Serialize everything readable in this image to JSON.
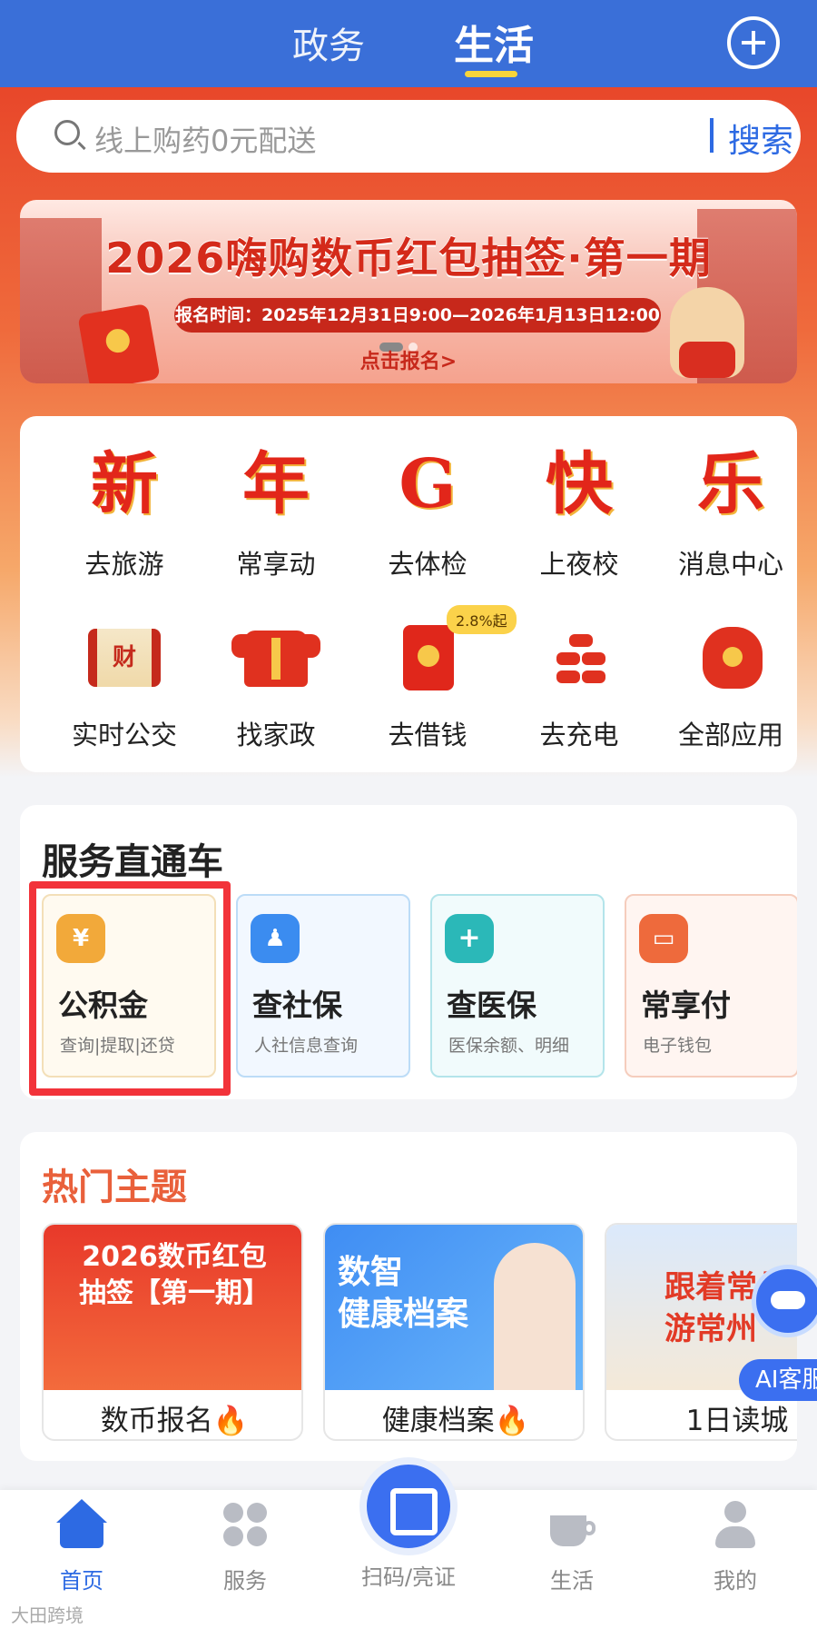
{
  "header": {
    "tabs": [
      {
        "label": "政务",
        "active": false
      },
      {
        "label": "生活",
        "active": true
      }
    ],
    "accent_color": "#3a6fd8",
    "plus_icon": "plus-circle-icon"
  },
  "search": {
    "placeholder": "线上购药0元配送",
    "button_label": "搜索"
  },
  "banner": {
    "title": "2026嗨购数币红包抽签·第一期",
    "date_text": "报名时间：2025年12月31日9:00—2026年1月13日12:00",
    "cta": "点击报名>",
    "slide_index": 1,
    "slide_count": 2
  },
  "apps": {
    "row1": [
      {
        "icon_char": "新",
        "label": "去旅游"
      },
      {
        "icon_char": "年",
        "label": "常享动"
      },
      {
        "icon_char": "G",
        "label": "去体检"
      },
      {
        "icon_char": "快",
        "label": "上夜校"
      },
      {
        "icon_char": "乐",
        "label": "消息中心"
      }
    ],
    "row2": [
      {
        "icon": "scroll-fortune-icon",
        "icon_text": "财",
        "label": "实时公交"
      },
      {
        "icon": "red-jacket-icon",
        "label": "找家政"
      },
      {
        "icon": "red-packet-icon",
        "label": "去借钱",
        "badge": "2.8%起"
      },
      {
        "icon": "firecracker-icon",
        "label": "去充电"
      },
      {
        "icon": "lucky-bag-icon",
        "label": "全部应用"
      }
    ]
  },
  "service": {
    "title": "服务直通车",
    "tiles": [
      {
        "title": "公积金",
        "subtitle": "查询|提取|还贷",
        "icon": "house-fund-icon",
        "icon_glyph": "¥",
        "color": "#f2a93a",
        "bg": "#fffaf0",
        "border": "#f3dfb8"
      },
      {
        "title": "查社保",
        "subtitle": "人社信息查询",
        "icon": "social-security-icon",
        "icon_glyph": "♟",
        "color": "#3b8cf0",
        "bg": "#f2f8ff",
        "border": "#bcdcf7"
      },
      {
        "title": "查医保",
        "subtitle": "医保余额、明细",
        "icon": "medical-insurance-icon",
        "icon_glyph": "+",
        "color": "#2bb8b8",
        "bg": "#f1fbfc",
        "border": "#b3e4ea"
      },
      {
        "title": "常享付",
        "subtitle": "电子钱包",
        "icon": "wallet-icon",
        "icon_glyph": "▭",
        "color": "#ee6a3c",
        "bg": "#fff5f1",
        "border": "#f5cdbd"
      }
    ]
  },
  "hot": {
    "title": "热门主题",
    "tiles": [
      {
        "label": "数币报名",
        "flame": "🔥",
        "image_text": "2026数币红包\n抽签【第一期】"
      },
      {
        "label": "健康档案",
        "flame": "🔥",
        "image_text": "数智\n健康档案"
      },
      {
        "label": "1日读城",
        "flame": "",
        "image_text": "跟着常州\n游常州"
      }
    ]
  },
  "ai": {
    "label": "AI客服"
  },
  "bottom_nav": {
    "items": [
      {
        "label": "首页",
        "icon": "home-icon",
        "active": true
      },
      {
        "label": "服务",
        "icon": "grid-icon",
        "active": false
      },
      {
        "label": "扫码/亮证",
        "icon": "qr-scan-icon",
        "active": false
      },
      {
        "label": "生活",
        "icon": "coffee-cup-icon",
        "active": false
      },
      {
        "label": "我的",
        "icon": "profile-icon",
        "active": false
      }
    ]
  },
  "watermark": "大田跨境"
}
